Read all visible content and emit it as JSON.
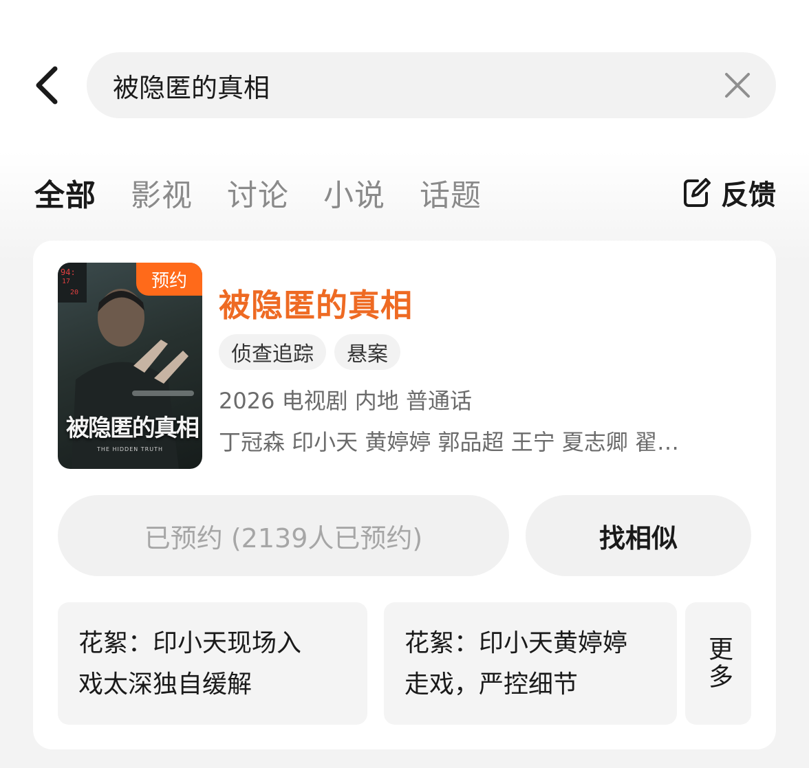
{
  "search": {
    "value": "被隐匿的真相"
  },
  "tabs": [
    {
      "label": "全部"
    },
    {
      "label": "影视"
    },
    {
      "label": "讨论"
    },
    {
      "label": "小说"
    },
    {
      "label": "话题"
    }
  ],
  "feedback": {
    "label": "反馈"
  },
  "result": {
    "title": "被隐匿的真相",
    "badge": "预约",
    "poster_title": "被隐匿的真相",
    "poster_subtitle": "THE HIDDEN TRUTH",
    "tags": [
      "侦查追踪",
      "悬案"
    ],
    "meta": "2026 电视剧 内地 普通话",
    "cast": "丁冠森 印小天 黄婷婷 郭品超 王宁 夏志卿 翟…",
    "reserve_label": "已预约 (2139人已预约)",
    "similar_label": "找相似",
    "clips": [
      {
        "line1": "花絮：印小天现场入",
        "line2": "戏太深独自缓解"
      },
      {
        "line1": "花絮：印小天黄婷婷",
        "line2": "走戏，严控细节"
      }
    ],
    "more_label": "更多"
  },
  "colors": {
    "accent": "#ee6a23",
    "badge": "#ff6a1a"
  }
}
